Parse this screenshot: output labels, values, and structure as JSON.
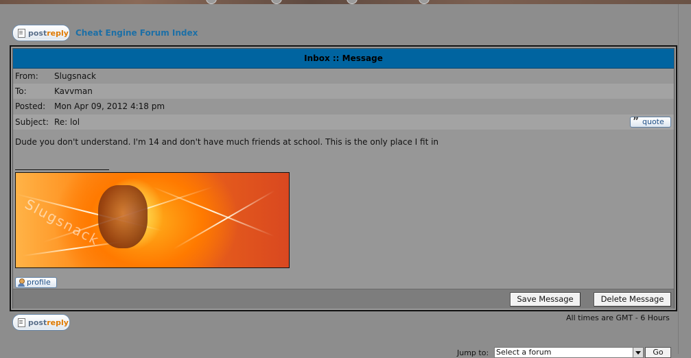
{
  "nav": {
    "postreply_prefix": "post",
    "postreply_suffix": "reply",
    "forum_index": "Cheat Engine Forum Index"
  },
  "message": {
    "header": "Inbox :: Message",
    "fields": [
      {
        "label": "From:",
        "value": "Slugsnack"
      },
      {
        "label": "To:",
        "value": "Kavvman"
      },
      {
        "label": "Posted:",
        "value": "Mon Apr 09, 2012 4:18 pm"
      },
      {
        "label": "Subject:",
        "value": "Re: lol"
      }
    ],
    "quote_label": "quote",
    "body": "Dude you don't understand. I'm 14 and don't have much friends at school. This is the only place I fit in",
    "signature_text": "Slugsnack",
    "profile_label": "profile"
  },
  "actions": {
    "save": "Save Message",
    "delete": "Delete Message"
  },
  "footer": {
    "timezone": "All times are GMT - 6 Hours",
    "jump_label": "Jump to:",
    "jump_select": "Select a forum",
    "go": "Go"
  },
  "colors": {
    "header_bg": "#0064a0",
    "link": "#1c6fa6",
    "page_bg": "#8d8d8d"
  }
}
